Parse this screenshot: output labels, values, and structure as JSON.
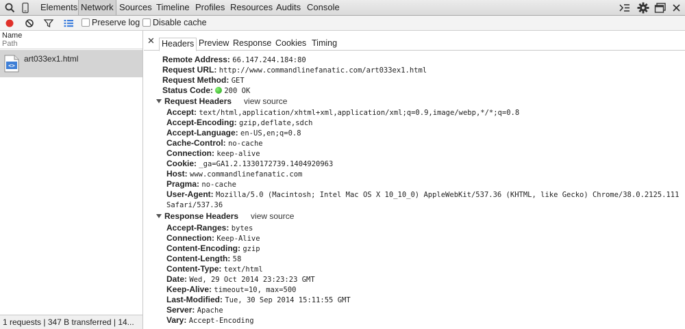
{
  "toolbar": {
    "tabs": [
      "Elements",
      "Network",
      "Sources",
      "Timeline",
      "Profiles",
      "Resources",
      "Audits",
      "Console"
    ],
    "active_tab": "Network"
  },
  "filterbar": {
    "preserve_log": "Preserve log",
    "disable_cache": "Disable cache"
  },
  "list": {
    "col_name": "Name",
    "col_path": "Path",
    "request_name": "art033ex1.html",
    "summary": "1 requests | 347 B transferred | 14..."
  },
  "detail_tabs": [
    "Headers",
    "Preview",
    "Response",
    "Cookies",
    "Timing"
  ],
  "general": [
    {
      "k": "Remote Address:",
      "v": "66.147.244.184:80"
    },
    {
      "k": "Request URL:",
      "v": "http://www.commandlinefanatic.com/art033ex1.html"
    },
    {
      "k": "Request Method:",
      "v": "GET"
    },
    {
      "k": "Status Code:",
      "v": "200 OK"
    }
  ],
  "request_headers": {
    "title": "Request Headers",
    "view_source": "view source",
    "items": [
      {
        "k": "Accept:",
        "v": "text/html,application/xhtml+xml,application/xml;q=0.9,image/webp,*/*;q=0.8"
      },
      {
        "k": "Accept-Encoding:",
        "v": "gzip,deflate,sdch"
      },
      {
        "k": "Accept-Language:",
        "v": "en-US,en;q=0.8"
      },
      {
        "k": "Cache-Control:",
        "v": "no-cache"
      },
      {
        "k": "Connection:",
        "v": "keep-alive"
      },
      {
        "k": "Cookie:",
        "v": "_ga=GA1.2.1330172739.1404920963"
      },
      {
        "k": "Host:",
        "v": "www.commandlinefanatic.com"
      },
      {
        "k": "Pragma:",
        "v": "no-cache"
      },
      {
        "k": "User-Agent:",
        "v": "Mozilla/5.0 (Macintosh; Intel Mac OS X 10_10_0) AppleWebKit/537.36 (KHTML, like Gecko) Chrome/38.0.2125.111",
        "v2": "Safari/537.36"
      }
    ]
  },
  "response_headers": {
    "title": "Response Headers",
    "view_source": "view source",
    "items": [
      {
        "k": "Accept-Ranges:",
        "v": "bytes"
      },
      {
        "k": "Connection:",
        "v": "Keep-Alive"
      },
      {
        "k": "Content-Encoding:",
        "v": "gzip"
      },
      {
        "k": "Content-Length:",
        "v": "58"
      },
      {
        "k": "Content-Type:",
        "v": "text/html"
      },
      {
        "k": "Date:",
        "v": "Wed, 29 Oct 2014 23:23:23 GMT"
      },
      {
        "k": "Keep-Alive:",
        "v": "timeout=10, max=500"
      },
      {
        "k": "Last-Modified:",
        "v": "Tue, 30 Sep 2014 15:11:55 GMT"
      },
      {
        "k": "Server:",
        "v": "Apache"
      },
      {
        "k": "Vary:",
        "v": "Accept-Encoding"
      }
    ]
  },
  "colors": {
    "record": "#e0312a",
    "filter_list_active": "#3b7ddd",
    "status_ok": "#29b31a"
  }
}
